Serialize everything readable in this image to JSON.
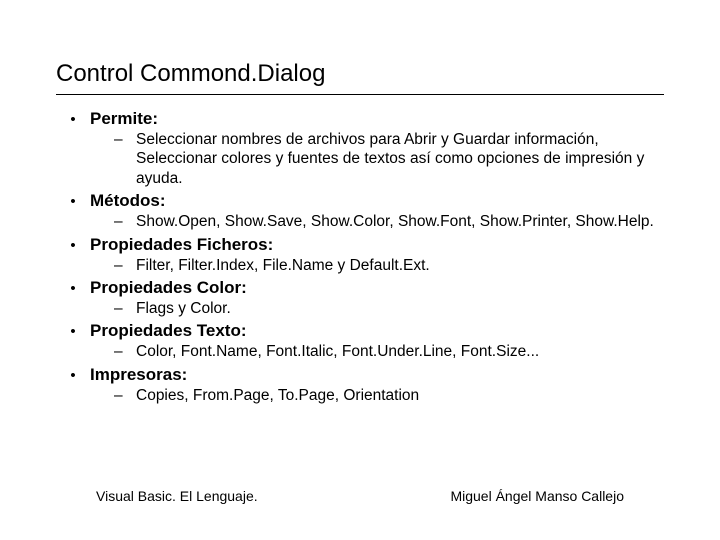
{
  "title": "Control Commond.Dialog",
  "sections": [
    {
      "label": "Permite:",
      "desc": "Seleccionar nombres de archivos para Abrir y Guardar información, Seleccionar colores y fuentes de textos así como opciones de impresión y ayuda."
    },
    {
      "label": "Métodos:",
      "desc": "Show.Open, Show.Save, Show.Color, Show.Font, Show.Printer, Show.Help."
    },
    {
      "label": "Propiedades Ficheros:",
      "desc": "Filter, Filter.Index, File.Name y Default.Ext."
    },
    {
      "label": "Propiedades Color:",
      "desc": "Flags y Color."
    },
    {
      "label": "Propiedades Texto:",
      "desc": "Color, Font.Name, Font.Italic, Font.Under.Line, Font.Size..."
    },
    {
      "label": "Impresoras:",
      "desc": "Copies, From.Page, To.Page, Orientation"
    }
  ],
  "footer": {
    "left": "Visual Basic. El Lenguaje.",
    "right": "Miguel Ángel Manso Callejo"
  }
}
